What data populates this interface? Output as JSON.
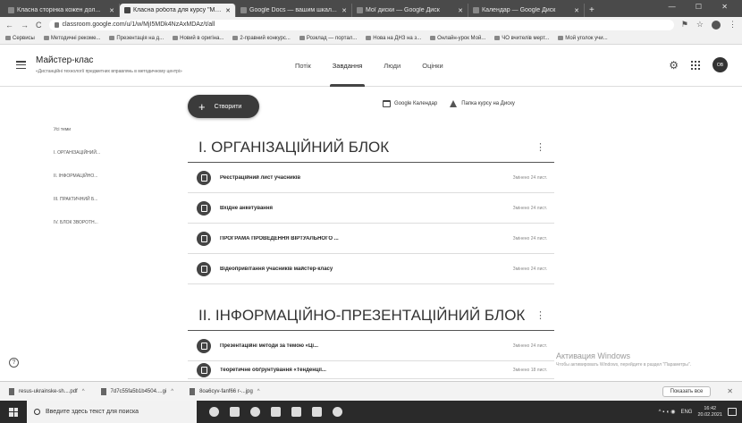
{
  "browser": {
    "tabs": [
      {
        "label": "Класна сторінка кожен дол...",
        "active": false
      },
      {
        "label": "Класна робота для курсу \"Май...",
        "active": true
      },
      {
        "label": "Google Docs — вашим шкал...",
        "active": false
      },
      {
        "label": "Мої диски — Google Диск",
        "active": false
      },
      {
        "label": "Календар — Google Диск",
        "active": false
      }
    ],
    "new_tab": "+",
    "window_controls": "— ☐ ✕",
    "url": "classroom.google.com/u/1/w/MjI5MDk4NzAxMDAz/t/all",
    "bookmarks": [
      "Сервисы",
      "Методичні рекоме...",
      "Презентація на д...",
      "Новий в оригіна...",
      "2-правний конкурс...",
      "Розклад — портал...",
      "Нова на ДНЗ на з...",
      "Онлайн-урок Мой...",
      "ЧО вчителів мерт...",
      "Мой уголок учи..."
    ]
  },
  "classroom": {
    "class_name": "Майстер-клас",
    "class_subtitle": "«Дистанційні технології предметних вправлянь в методичному центрі»",
    "tabs": [
      "Потік",
      "Завдання",
      "Люди",
      "Оцінки"
    ],
    "active_tab": "Завдання",
    "account_initials": "ОВ",
    "create_button": "Створити",
    "calendar_link": "Google Календар",
    "drive_link": "Папка курсу на Диску",
    "topics": [
      "Усі теми",
      "І. ОРГАНІЗАЦІЙНИЙ...",
      "ІІ. ІНФОРМАЦІЙНО...",
      "ІІІ. ПРАКТИЧНИЙ Б...",
      "ІV. БЛОК ЗВОРОТН..."
    ],
    "sections": [
      {
        "title": "І. ОРГАНІЗАЦІЙНИЙ БЛОК",
        "items": [
          {
            "title": "Реєстраційний лист учасників",
            "date": "Змінено 24 лист."
          },
          {
            "title": "Вхідне анкетування",
            "date": "Змінено 24 лист."
          },
          {
            "title": "ПРОГРАМА ПРОВЕДЕННЯ ВІРТУАЛЬНОГО ...",
            "date": "Змінено 24 лист."
          },
          {
            "title": "Відеопривітання учасників майстер-класу",
            "date": "Змінено 24 лист."
          }
        ]
      },
      {
        "title": "ІІ. ІНФОРМАЦІЙНО-ПРЕЗЕНТАЦІЙНИЙ БЛОК",
        "items": [
          {
            "title": "Презентаційні методи за темою «Ці... ",
            "date": "Змінено 24 лист."
          },
          {
            "title": "Теоретичне обґрунтування «Тенденції...",
            "date": "Змінено 18 лист."
          }
        ]
      }
    ]
  },
  "activation": {
    "title": "Активация Windows",
    "text": "Чтобы активировать Windows, перейдите в раздел \"Параметры\"."
  },
  "downloads": {
    "files": [
      "resus-ukrainske-sh....pdf",
      "7d7c55fa5b1b4504....gi",
      "8oa6cyv-fanf66 r-...jpg"
    ],
    "show_all": "Показать все",
    "close": "✕"
  },
  "taskbar": {
    "search_placeholder": "Введите здесь текст для поиска",
    "tray_lang": "ENG",
    "time": "16:42",
    "date": "20.02.2021"
  }
}
